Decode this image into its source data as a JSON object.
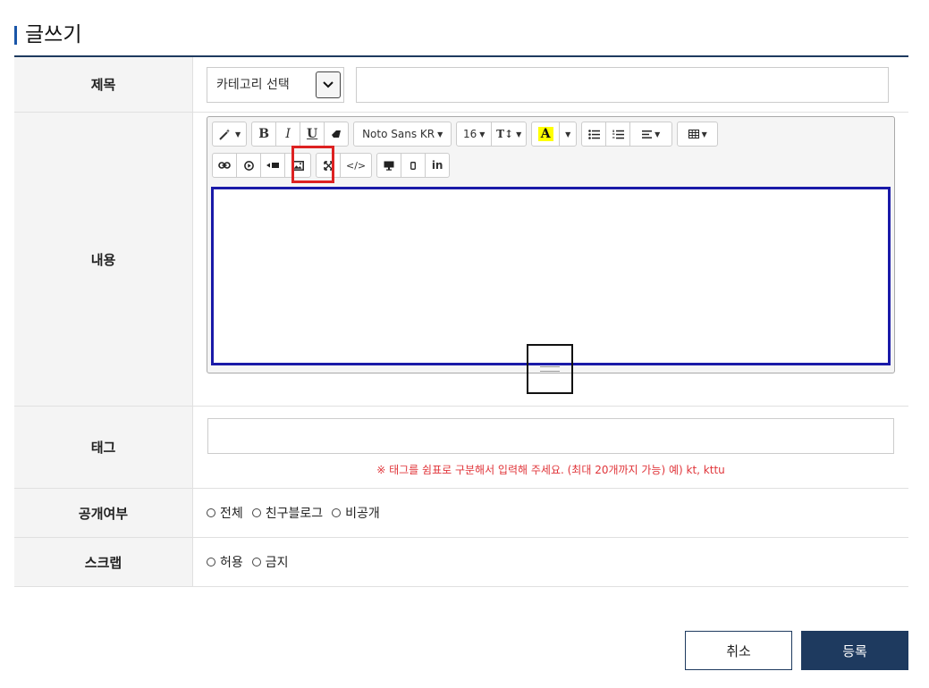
{
  "page": {
    "title": "글쓰기"
  },
  "form": {
    "title_row": {
      "label": "제목",
      "category_selected": "카테고리 선택",
      "title_value": ""
    },
    "content_row": {
      "label": "내용",
      "toolbar": {
        "font_family": "Noto Sans KR",
        "font_size": "16",
        "bold": "B",
        "italic": "I",
        "underline": "U",
        "line_height": "T↕",
        "font_color": "A",
        "code_view": "</>",
        "linkedin": "in"
      },
      "editor_value": ""
    },
    "tag_row": {
      "label": "태그",
      "tag_value": "",
      "hint": "※ 태그를 쉼표로 구분해서 입력해 주세요. (최대 20개까지 가능) 예) kt, kttu"
    },
    "public_row": {
      "label": "공개여부",
      "options": [
        "전체",
        "친구블로그",
        "비공개"
      ]
    },
    "scrap_row": {
      "label": "스크랩",
      "options": [
        "허용",
        "금지"
      ]
    }
  },
  "actions": {
    "cancel": "취소",
    "submit": "등록"
  },
  "colors": {
    "accent": "#1e3a5f",
    "highlight_box": "#d22222",
    "editor_border": "#1a1aa8",
    "hint": "#e0353a"
  }
}
